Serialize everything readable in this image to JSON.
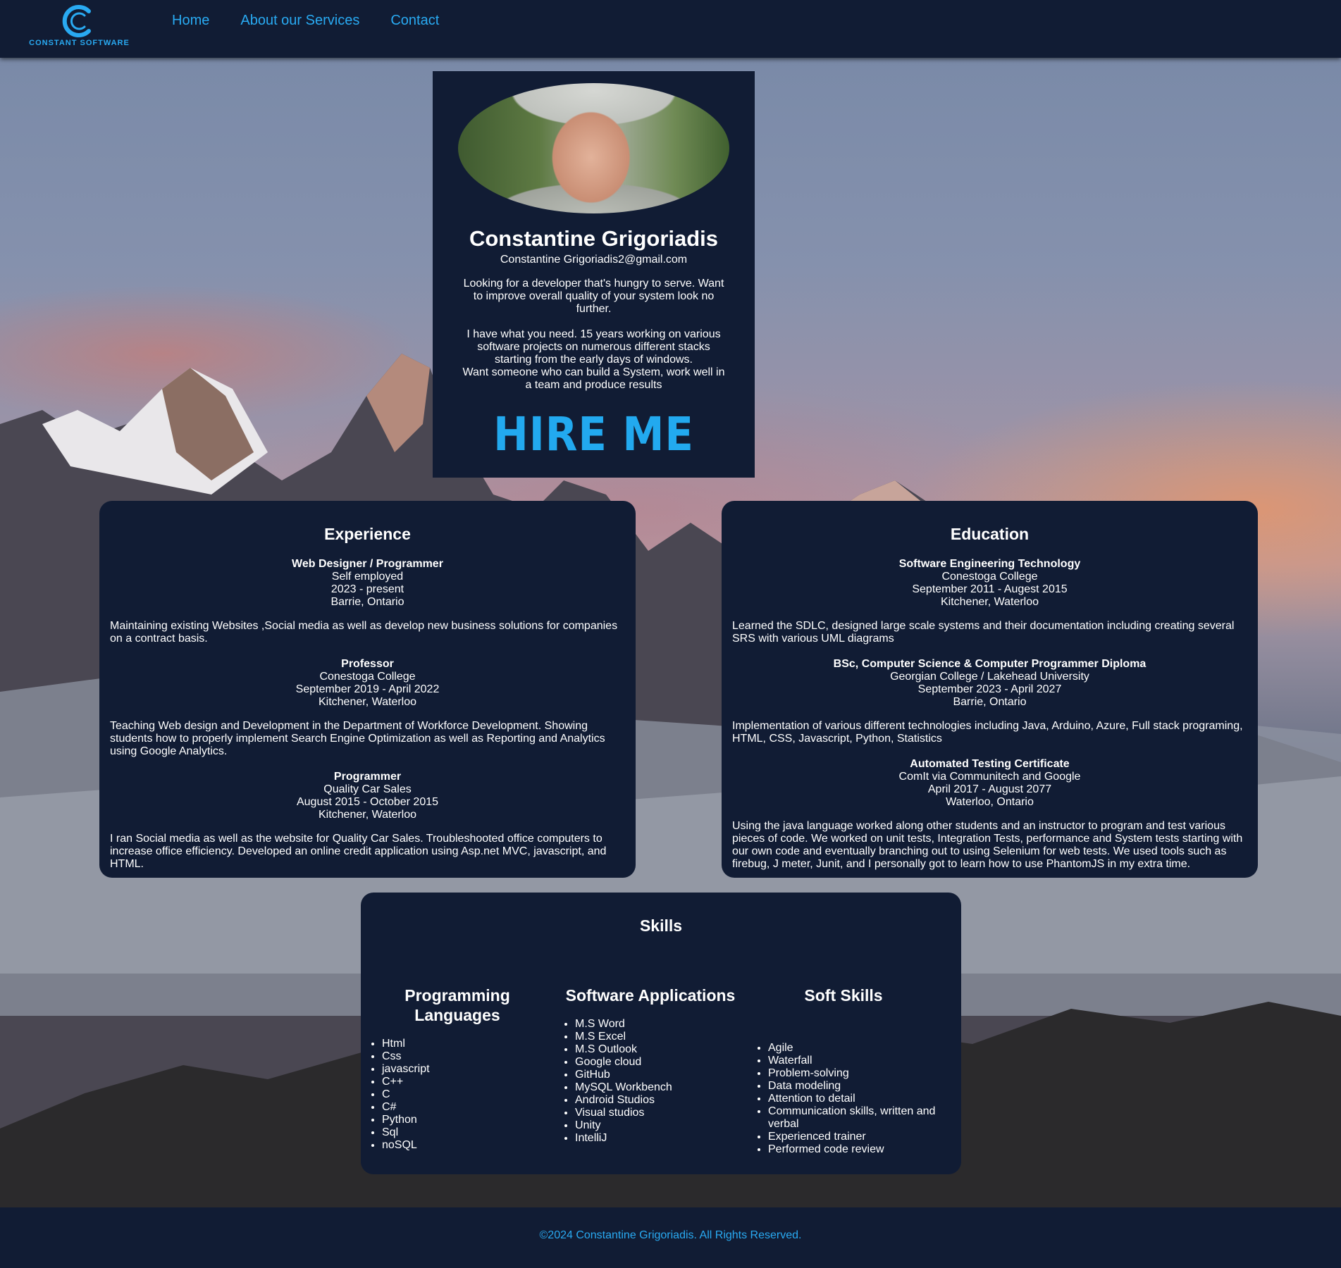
{
  "brand": {
    "logo_text": "CONSTANT SOFTWARE",
    "accent_color": "#29aaf2",
    "panel_color": "#111c34"
  },
  "nav": {
    "items": [
      "Home",
      "About our Services",
      "Contact"
    ]
  },
  "profile": {
    "name": "Constantine Grigoriadis",
    "email": "Constantine Grigoriadis2@gmail.com",
    "blurb_1": "Looking for a developer that's hungry to serve. Want to improve overall quality of your system look no further.",
    "blurb_2": "I have what you need. 15 years working on various software projects on numerous different stacks starting from the early days of windows.",
    "blurb_3": "Want someone who can build a System, work well in a team and produce results",
    "hire_label": "HIRE ME"
  },
  "experience": {
    "title": "Experience",
    "entries": [
      {
        "role": "Web Designer / Programmer",
        "org": "Self employed",
        "dates": "2023 - present",
        "location": "Barrie, Ontario",
        "description": "Maintaining existing Websites ,Social media as well as develop new business solutions for companies on a contract basis."
      },
      {
        "role": "Professor",
        "org": "Conestoga College",
        "dates": "September 2019 - April 2022",
        "location": "Kitchener, Waterloo",
        "description": "Teaching Web design and Development in the Department of Workforce Development. Showing students how to properly implement Search Engine Optimization as well as Reporting and Analytics using Google Analytics."
      },
      {
        "role": "Programmer",
        "org": "Quality Car Sales",
        "dates": "August 2015 - October 2015",
        "location": "Kitchener, Waterloo",
        "description": "I ran Social media as well as the website for Quality Car Sales. Troubleshooted office computers to increase office efficiency. Developed an online credit application using Asp.net MVC, javascript, and HTML."
      }
    ]
  },
  "education": {
    "title": "Education",
    "entries": [
      {
        "role": "Software Engineering Technology",
        "org": "Conestoga College",
        "dates": "September 2011 - Augest 2015",
        "location": "Kitchener, Waterloo",
        "description": "Learned the SDLC, designed large scale systems and their documentation including creating several SRS with various UML diagrams"
      },
      {
        "role": "BSc, Computer Science & Computer Programmer Diploma",
        "org": "Georgian College / Lakehead University",
        "dates": "September 2023 - April 2027",
        "location": "Barrie, Ontario",
        "description": "Implementation of various different technologies including Java, Arduino, Azure, Full stack programing, HTML, CSS, Javascript, Python, Statistics"
      },
      {
        "role": "Automated Testing Certificate",
        "org": "ComIt via Communitech and Google",
        "dates": "April 2017 - August 2077",
        "location": "Waterloo, Ontario",
        "description": "Using the java language worked along other students and an instructor to program and test various pieces of code. We worked on unit tests, Integration Tests, performance and System tests starting with our own code and eventually branching out to using Selenium for web tests. We used tools such as firebug, J meter, Junit, and I personally got to learn how to use PhantomJS in my extra time."
      }
    ]
  },
  "skills": {
    "title": "Skills",
    "columns": [
      {
        "title": "Programming Languages",
        "items": [
          "Html",
          "Css",
          "javascript",
          "C++",
          "C",
          "C#",
          "Python",
          "Sql",
          "noSQL"
        ]
      },
      {
        "title": "Software Applications",
        "items": [
          "M.S Word",
          "M.S Excel",
          "M.S Outlook",
          "Google cloud",
          "GitHub",
          "MySQL Workbench",
          "Android Studios",
          "Visual studios",
          "Unity",
          "IntelliJ"
        ]
      },
      {
        "title": "Soft Skills",
        "items": [
          "Agile",
          "Waterfall",
          "Problem-solving",
          "Data modeling",
          "Attention to detail",
          "Communication skills, written and verbal",
          "Experienced trainer",
          "Performed code review"
        ]
      }
    ]
  },
  "footer": {
    "text": "©2024 Constantine Grigoriadis. All Rights Reserved."
  }
}
